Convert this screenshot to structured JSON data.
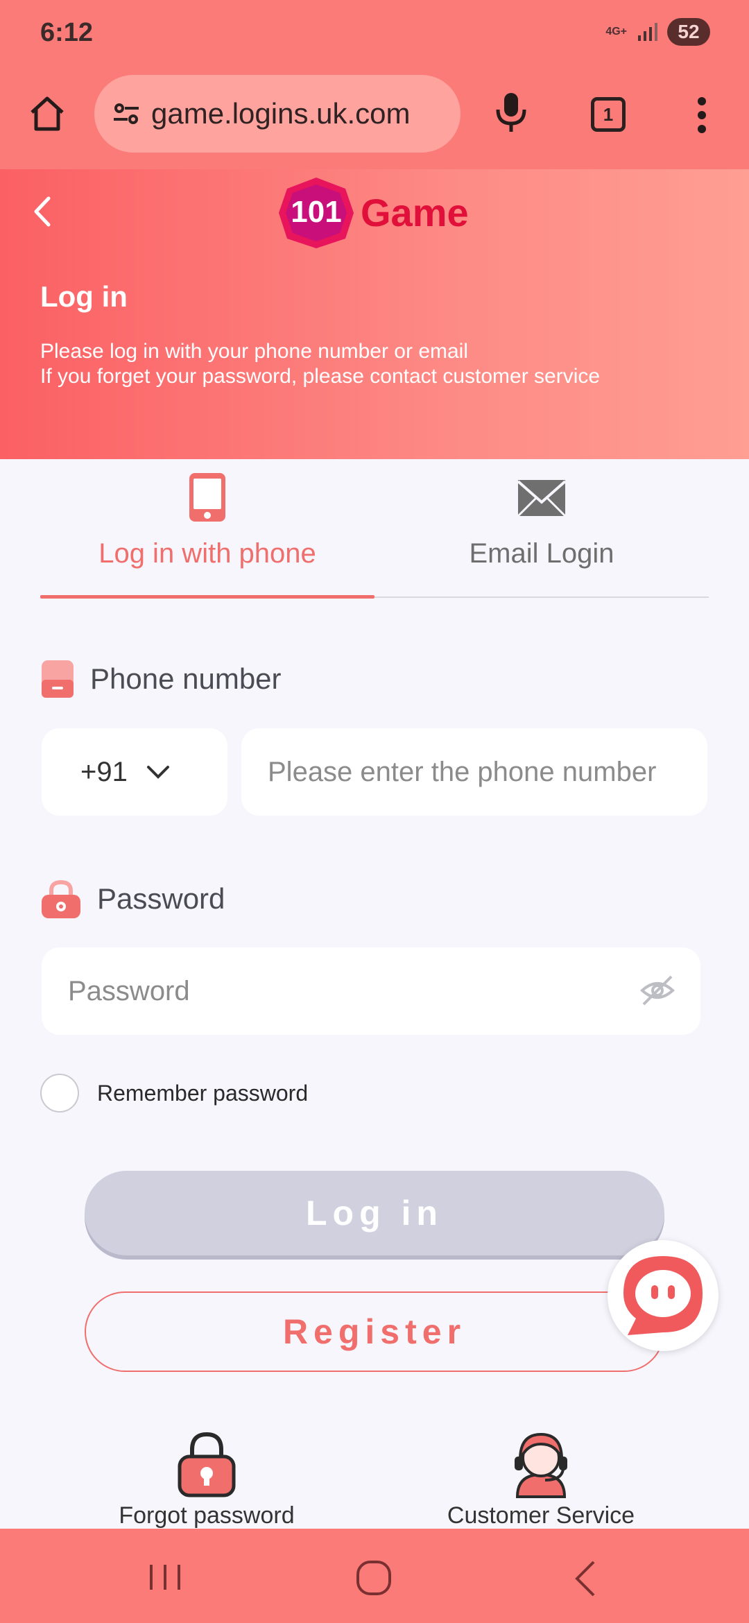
{
  "status_bar": {
    "time": "6:12",
    "network": "4G+",
    "battery": "52"
  },
  "browser": {
    "url": "game.logins.uk.com",
    "tab_count": "1"
  },
  "header": {
    "logo_text": "Game",
    "logo_number": "101",
    "title": "Log in",
    "subtitle_line1": "Please log in with your phone number or email",
    "subtitle_line2": "If you forget your password, please contact customer service"
  },
  "tabs": {
    "phone_label": "Log in with phone",
    "email_label": "Email Login",
    "active": "phone"
  },
  "form": {
    "phone_label": "Phone number",
    "country_code": "+91",
    "phone_placeholder": "Please enter the phone number",
    "password_label": "Password",
    "password_placeholder": "Password",
    "remember_label": "Remember password",
    "remember_checked": false
  },
  "buttons": {
    "login": "Log in",
    "register": "Register"
  },
  "links": {
    "forgot": "Forgot password",
    "service": "Customer Service"
  },
  "colors": {
    "accent": "#f06e6c",
    "chrome": "#fb7b79",
    "disabled_button": "#d0d0de"
  }
}
